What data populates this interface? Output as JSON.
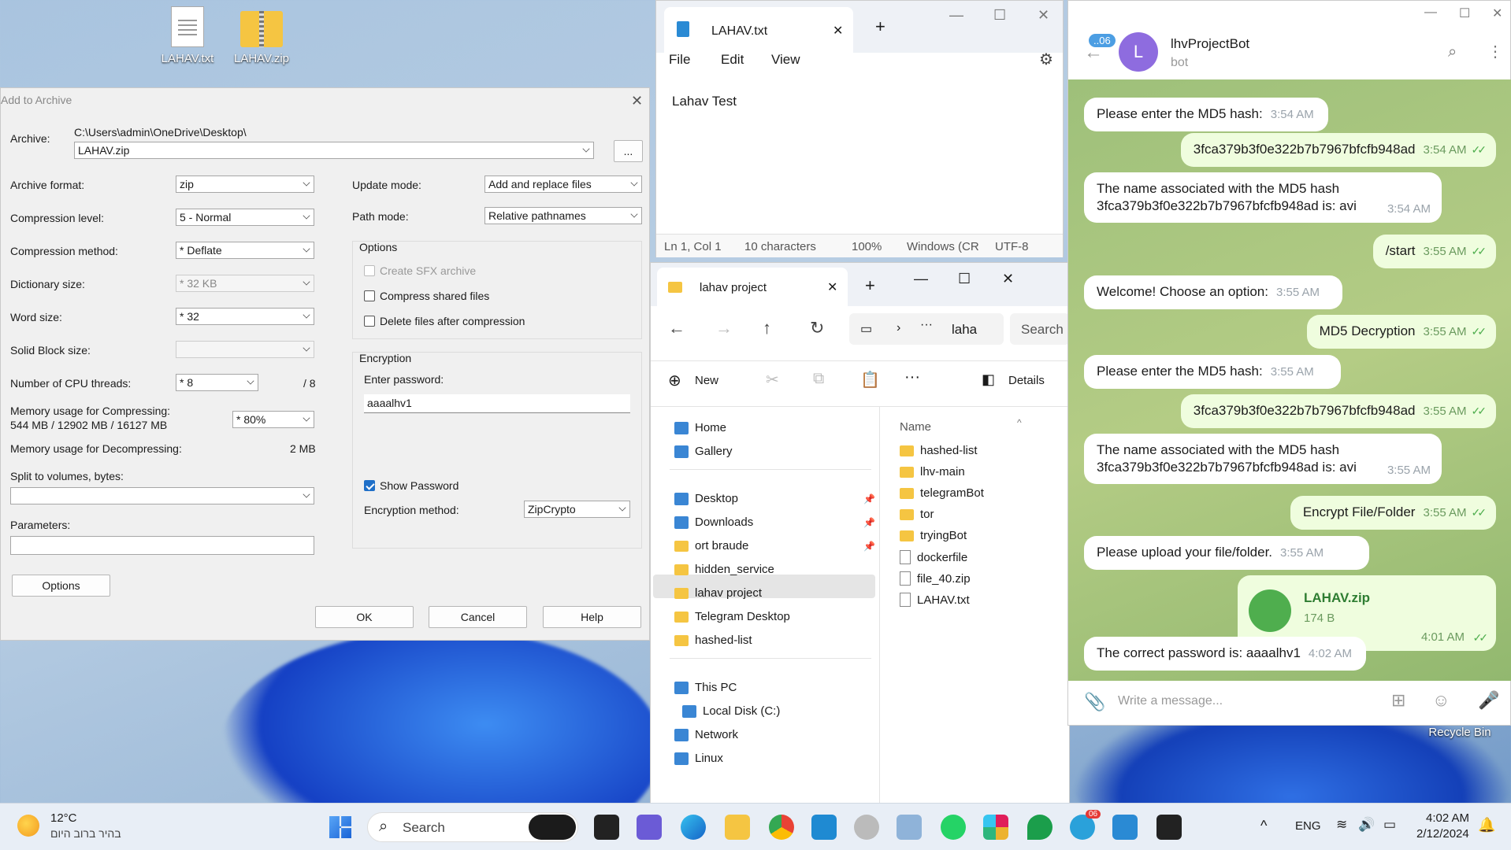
{
  "desktop": {
    "icons": [
      {
        "label": "LAHAV.txt"
      },
      {
        "label": "LAHAV.zip"
      }
    ],
    "recycle_bin": "Recycle Bin"
  },
  "archive": {
    "title": "Add to Archive",
    "archive_label": "Archive:",
    "archive_path": "C:\\Users\\admin\\OneDrive\\Desktop\\",
    "archive_name": "LAHAV.zip",
    "browse": "...",
    "format_label": "Archive format:",
    "format": "zip",
    "level_label": "Compression level:",
    "level": "5 - Normal",
    "method_label": "Compression method:",
    "method": "* Deflate",
    "dict_label": "Dictionary size:",
    "dict": "* 32 KB",
    "word_label": "Word size:",
    "word": "* 32",
    "solid_label": "Solid Block size:",
    "solid": "",
    "cpu_label": "Number of CPU threads:",
    "cpu": "* 8",
    "cpu_max": "/ 8",
    "mem_comp_label": "Memory usage for Compressing:",
    "mem_comp_values": "544 MB / 12902 MB / 16127 MB",
    "mem_comp_pct": "* 80%",
    "mem_decomp_label": "Memory usage for Decompressing:",
    "mem_decomp": "2 MB",
    "split_label": "Split to volumes, bytes:",
    "params_label": "Parameters:",
    "options_btn": "Options",
    "update_label": "Update mode:",
    "update": "Add and replace files",
    "path_label": "Path mode:",
    "path": "Relative pathnames",
    "options_group": "Options",
    "sfx": "Create SFX archive",
    "compress_shared": "Compress shared files",
    "delete_after": "Delete files after compression",
    "enc_group": "Encryption",
    "enter_pw": "Enter password:",
    "password": "aaaalhv1",
    "show_pw": "Show Password",
    "enc_method_label": "Encryption method:",
    "enc_method": "ZipCrypto",
    "ok": "OK",
    "cancel": "Cancel",
    "help": "Help"
  },
  "notepad": {
    "tab": "LAHAV.txt",
    "menu": [
      "File",
      "Edit",
      "View"
    ],
    "content": "Lahav Test",
    "status": [
      "Ln 1, Col 1",
      "10 characters",
      "100%",
      "Windows (CR",
      "UTF-8"
    ]
  },
  "explorer": {
    "tab": "lahav project",
    "address": "laha",
    "search": "Search",
    "new": "New",
    "details": "Details",
    "nav": [
      {
        "label": "Home"
      },
      {
        "label": "Gallery"
      },
      {
        "label": "Desktop"
      },
      {
        "label": "Downloads"
      },
      {
        "label": "ort braude"
      },
      {
        "label": "hidden_service"
      },
      {
        "label": "lahav project"
      },
      {
        "label": "Telegram Desktop"
      },
      {
        "label": "hashed-list"
      },
      {
        "label": "This PC"
      },
      {
        "label": "Local Disk (C:)"
      },
      {
        "label": "Network"
      },
      {
        "label": "Linux"
      }
    ],
    "col_name": "Name",
    "files": [
      {
        "name": "hashed-list",
        "type": "folder"
      },
      {
        "name": "lhv-main",
        "type": "folder"
      },
      {
        "name": "telegramBot",
        "type": "folder"
      },
      {
        "name": "tor",
        "type": "folder"
      },
      {
        "name": "tryingBot",
        "type": "folder"
      },
      {
        "name": "dockerfile",
        "type": "file"
      },
      {
        "name": "file_40.zip",
        "type": "zip"
      },
      {
        "name": "LAHAV.txt",
        "type": "txt"
      }
    ]
  },
  "telegram": {
    "badge": "..06",
    "avatar": "L",
    "name": "lhvProjectBot",
    "status": "bot",
    "input_placeholder": "Write a message...",
    "messages": [
      {
        "dir": "in",
        "text": "Please enter the MD5 hash:",
        "time": "3:54 AM"
      },
      {
        "dir": "out",
        "text": "3fca379b3f0e322b7b7967bfcfb948ad",
        "time": "3:54 AM"
      },
      {
        "dir": "in",
        "text": "The name associated with the MD5 hash",
        "text2": "3fca379b3f0e322b7b7967bfcfb948ad is: avi",
        "time": "3:54 AM"
      },
      {
        "dir": "out",
        "text": "/start",
        "time": "3:55 AM"
      },
      {
        "dir": "in",
        "text": "Welcome! Choose an option:",
        "time": "3:55 AM"
      },
      {
        "dir": "out",
        "text": "MD5 Decryption",
        "time": "3:55 AM"
      },
      {
        "dir": "in",
        "text": "Please enter the MD5 hash:",
        "time": "3:55 AM"
      },
      {
        "dir": "out",
        "text": "3fca379b3f0e322b7b7967bfcfb948ad",
        "time": "3:55 AM"
      },
      {
        "dir": "in",
        "text": "The name associated with the MD5 hash",
        "text2": "3fca379b3f0e322b7b7967bfcfb948ad is: avi",
        "time": "3:55 AM"
      },
      {
        "dir": "out",
        "text": "Encrypt File/Folder",
        "time": "3:55 AM"
      },
      {
        "dir": "in",
        "text": "Please upload your file/folder.",
        "time": "3:55 AM"
      },
      {
        "dir": "out",
        "text": "LAHAV.zip",
        "size": "174 B",
        "time": "4:01 AM"
      },
      {
        "dir": "in",
        "text": "The correct password is: aaaalhv1",
        "time": "4:02 AM"
      }
    ]
  },
  "taskbar": {
    "temp": "12°C",
    "weather": "בהיר ברוב היום",
    "search": "Search",
    "lang": "ENG",
    "time": "4:02 AM",
    "date": "2/12/2024",
    "tg_badge": "06"
  }
}
